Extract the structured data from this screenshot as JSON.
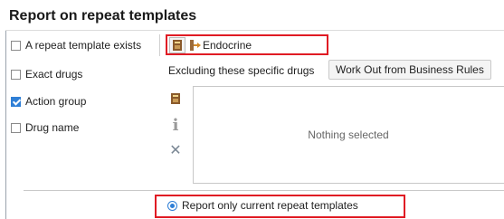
{
  "title": "Report on repeat templates",
  "options": {
    "repeat_template_exists": {
      "label": "A repeat template exists",
      "checked": false
    },
    "exact_drugs": {
      "label": "Exact drugs",
      "checked": false
    },
    "action_group": {
      "label": "Action group",
      "checked": true
    },
    "drug_name": {
      "label": "Drug name",
      "checked": false
    }
  },
  "selected_group": {
    "value": "Endocrine",
    "icon": "concept-arrow-icon"
  },
  "excluding": {
    "label": "Excluding these specific drugs",
    "work_out_button": "Work Out from Business Rules",
    "empty_text": "Nothing selected",
    "side_icons": [
      "book-icon",
      "info-icon",
      "close-icon"
    ]
  },
  "report_mode": {
    "label": "Report only current repeat templates",
    "selected": true
  },
  "colors": {
    "highlight": "#e01b24",
    "accent": "#2f7fd6"
  }
}
